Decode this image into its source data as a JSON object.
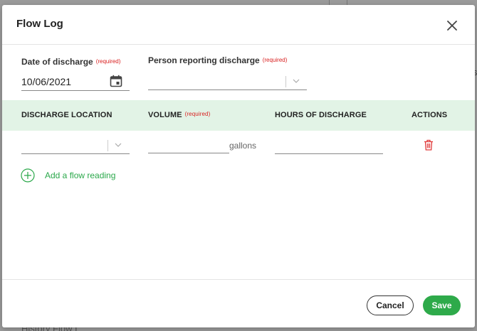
{
  "backdrop": {
    "partial_text": "History Flow L",
    "partial_s": "s"
  },
  "modal": {
    "title": "Flow Log"
  },
  "form": {
    "date_label": "Date of discharge",
    "required_tag": "(required)",
    "date_value": "10/06/2021",
    "person_label": "Person reporting discharge",
    "person_value": ""
  },
  "table": {
    "headers": {
      "location": "DISCHARGE LOCATION",
      "volume": "VOLUME",
      "hours": "HOURS OF DISCHARGE",
      "actions": "ACTIONS"
    },
    "row": {
      "location_value": "",
      "volume_value": "",
      "volume_unit": "gallons",
      "hours_value": ""
    },
    "add_label": "Add a flow reading"
  },
  "footer": {
    "cancel_label": "Cancel",
    "save_label": "Save"
  },
  "colors": {
    "accent": "#2eaa4a",
    "required": "#d92020",
    "table_header_bg": "#e2f3e6",
    "delete": "#e03a3a"
  },
  "icons": [
    "close-icon",
    "calendar-icon",
    "chevron-down-icon",
    "trash-icon",
    "plus-circle-icon"
  ]
}
